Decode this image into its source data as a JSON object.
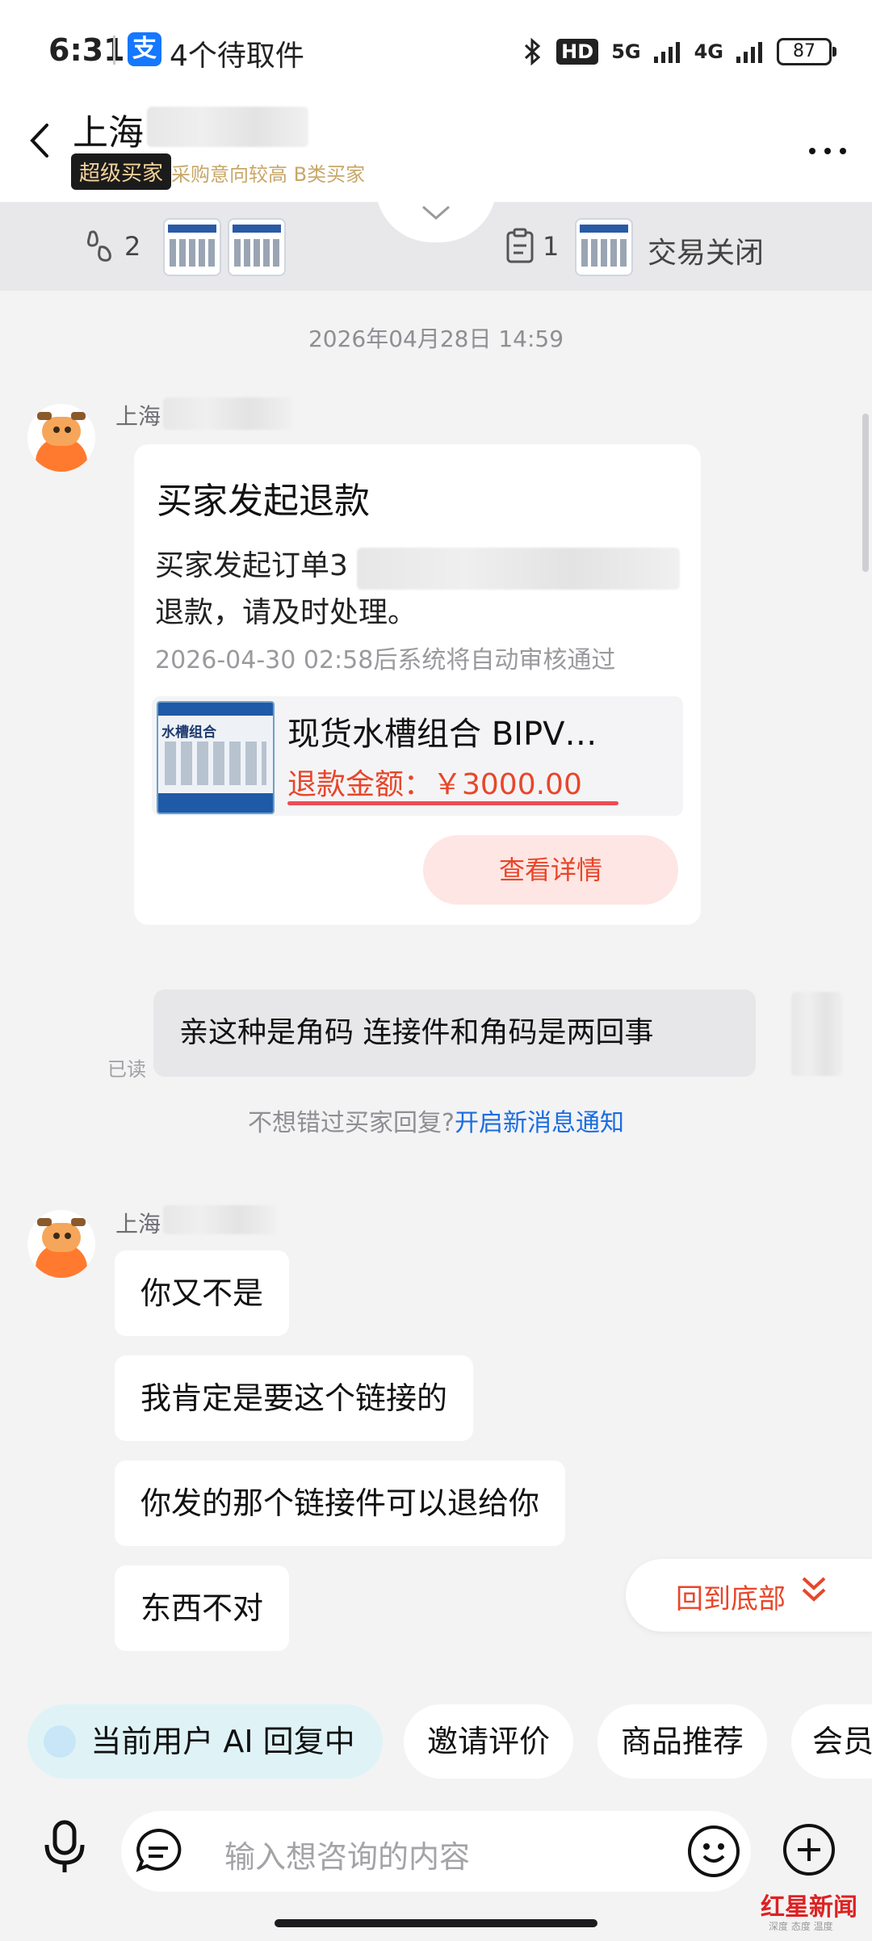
{
  "status_bar": {
    "time": "6:31",
    "alipay_glyph": "支",
    "notification": "4个待取件",
    "hd": "HD",
    "net1": "5G",
    "net2": "4G",
    "battery": "87"
  },
  "header": {
    "title": "上海",
    "tag": "超级买家",
    "subtags": "采购意向较高  B类买家"
  },
  "activity": {
    "footprint_count": "2",
    "order_count": "1",
    "status": "交易关闭"
  },
  "chat": {
    "date": "2026年04月28日 14:59",
    "sender": "上海",
    "refund_card": {
      "title": "买家发起退款",
      "desc_line1": "买家发起订单3",
      "desc_line2": "退款，请及时处理。",
      "note": "2026-04-30 02:58后系统将自动审核通过",
      "product_name": "现货水槽组合 BIPV…",
      "product_img_label": "水槽组合",
      "refund_text": "退款金额：￥3000.00",
      "button": "查看详情"
    },
    "outgoing": "亲这种是角码  连接件和角码是两回事",
    "read_label": "已读",
    "notify_text": "不想错过买家回复?",
    "notify_link": "开启新消息通知",
    "sender2": "上海",
    "messages": [
      "你又不是",
      "我肯定是要这个链接的",
      "你发的那个链接件可以退给你",
      "东西不对"
    ]
  },
  "back_to_bottom": "回到底部",
  "chips": [
    "当前用户 AI 回复中",
    "邀请评价",
    "商品推荐",
    "会员"
  ],
  "input": {
    "placeholder": "输入想咨询的内容"
  },
  "watermark": {
    "main": "红星新闻",
    "sub": "深度 态度 温度"
  },
  "colors": {
    "accent": "#e8462a",
    "link": "#1a6de0",
    "tag_gold": "#c8a768"
  },
  "icons": [
    "back-arrow-icon",
    "more-icon",
    "footprint-icon",
    "clipboard-icon",
    "chevron-down-icon",
    "mic-icon",
    "chat-bubble-icon",
    "emoji-icon",
    "plus-icon"
  ]
}
